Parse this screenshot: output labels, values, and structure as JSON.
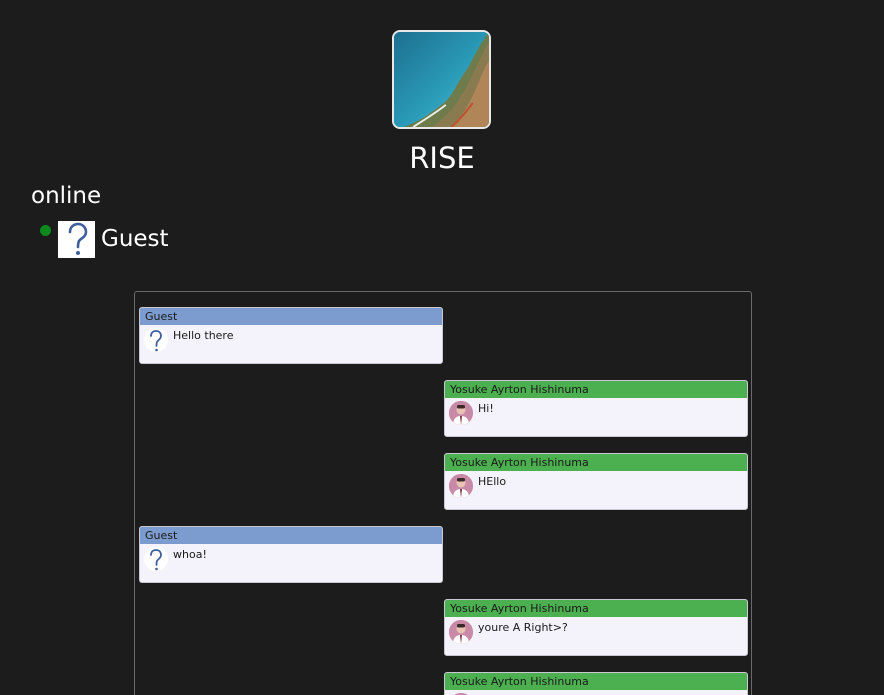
{
  "app": {
    "title": "RISE"
  },
  "online": {
    "heading": "online",
    "users": [
      {
        "name": "Guest",
        "status": "online",
        "avatar_icon": "question-mark-icon"
      }
    ]
  },
  "colors": {
    "background": "#1c1c1c",
    "guest_header": "#7c9ccf",
    "user_header": "#4caf50",
    "status_online": "#0a8a1c",
    "bubble_body": "#f4f2fb"
  },
  "messages": [
    {
      "sender": "Guest",
      "text": "Hello there",
      "side": "left",
      "avatar_icon": "question-mark-icon"
    },
    {
      "sender": "Yosuke Ayrton Hishinuma",
      "text": "Hi!",
      "side": "right",
      "avatar_icon": "user-photo-icon"
    },
    {
      "sender": "Yosuke Ayrton Hishinuma",
      "text": "HEllo",
      "side": "right",
      "avatar_icon": "user-photo-icon"
    },
    {
      "sender": "Guest",
      "text": "whoa!",
      "side": "left",
      "avatar_icon": "question-mark-icon"
    },
    {
      "sender": "Yosuke Ayrton Hishinuma",
      "text": "youre A Right>?",
      "side": "right",
      "avatar_icon": "user-photo-icon"
    },
    {
      "sender": "Yosuke Ayrton Hishinuma",
      "text": "",
      "side": "right",
      "avatar_icon": "user-photo-icon"
    }
  ]
}
